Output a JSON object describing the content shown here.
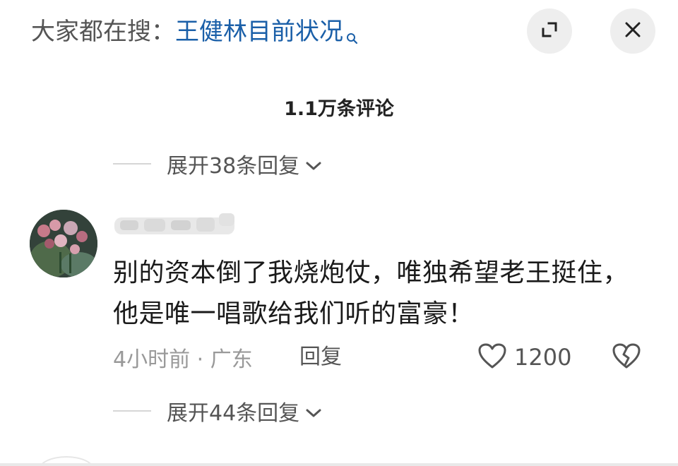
{
  "header": {
    "search_prefix": "大家都在搜：",
    "search_term": "王健林目前状况",
    "search_icon": "magnifier-icon",
    "expand_icon": "expand-corners-icon",
    "close_icon": "close-x-icon"
  },
  "comments_header": {
    "count_label": "1.1万条评论"
  },
  "replies_before": {
    "label": "展开38条回复"
  },
  "comment": {
    "avatar": "flower-avatar",
    "username_blurred": true,
    "text": "别的资本倒了我烧炮仗，唯独希望老王挺住，他是唯一唱歌给我们听的富豪！",
    "meta": "4小时前 · 广东",
    "reply_label": "回复",
    "like_count": "1200",
    "like_icon": "heart-outline-icon",
    "dislike_icon": "broken-heart-icon"
  },
  "replies_after": {
    "label": "展开44条回复"
  },
  "colors": {
    "search_term": "#1a5fa8",
    "muted": "#999999",
    "text": "#1a1a1a",
    "button_bg": "#eeeeee"
  }
}
